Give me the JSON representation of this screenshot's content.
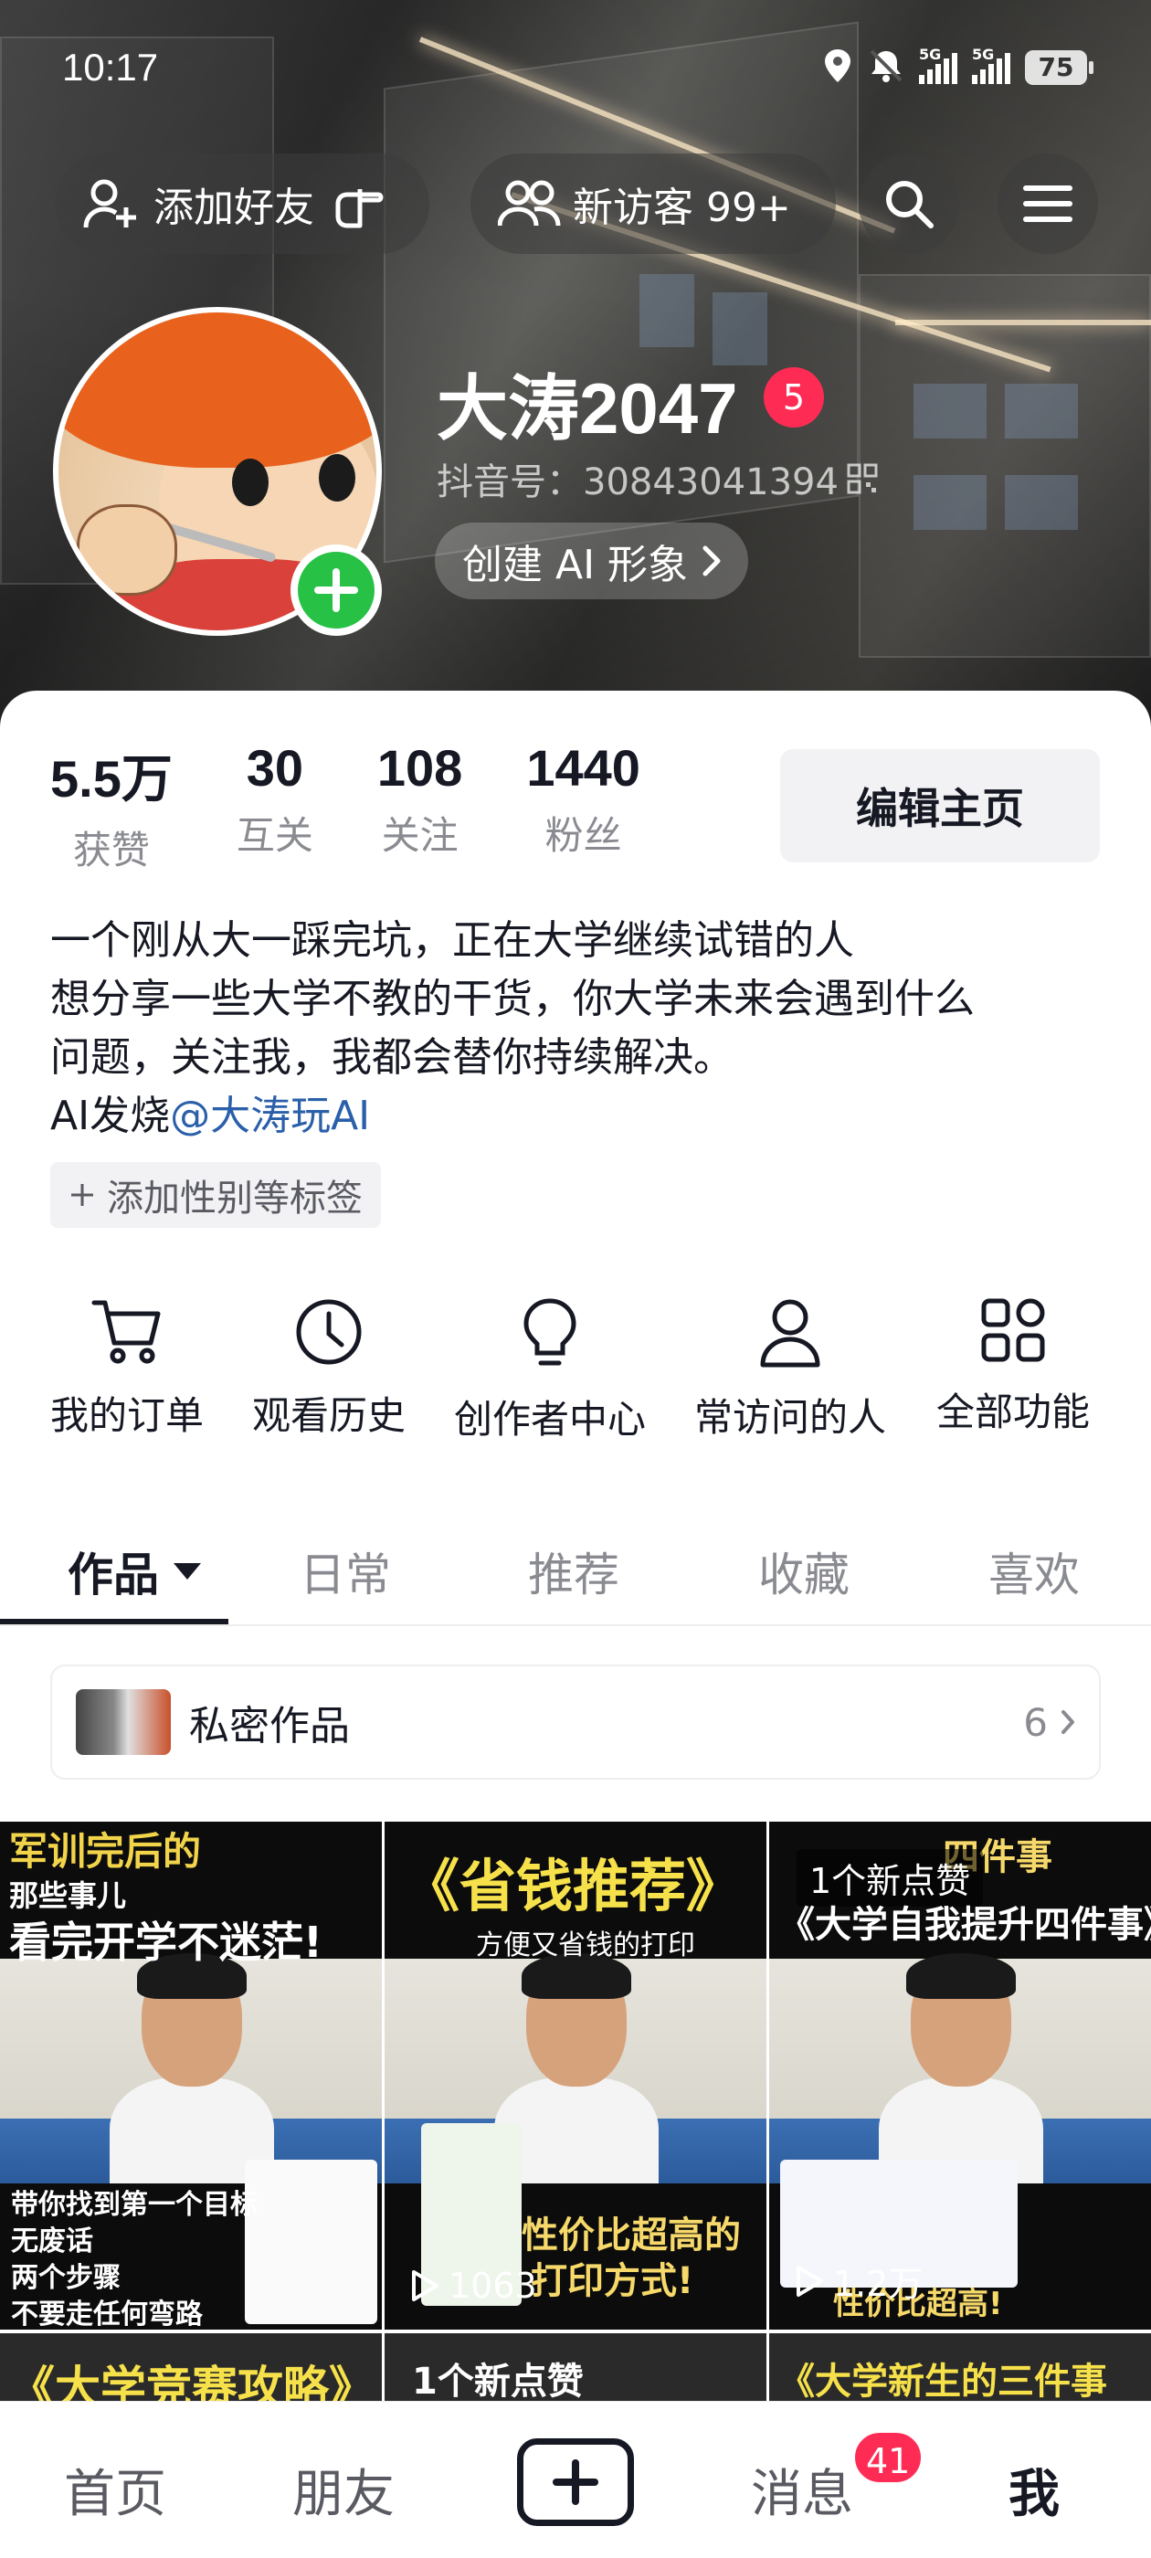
{
  "status_bar": {
    "time": "10:17",
    "signal1": "5G",
    "signal2": "5G",
    "battery": "75"
  },
  "top_actions": {
    "add_friend": "添加好友",
    "new_visitors": "新访客 99+"
  },
  "profile": {
    "name": "大涛2047",
    "name_badge": "5",
    "douyin_id": "抖音号：30843041394",
    "create_ai": "创建 AI 形象"
  },
  "stats": [
    {
      "value": "5.5万",
      "label": "获赞"
    },
    {
      "value": "30",
      "label": "互关"
    },
    {
      "value": "108",
      "label": "关注"
    },
    {
      "value": "1440",
      "label": "粉丝"
    }
  ],
  "edit_profile": "编辑主页",
  "bio": {
    "line1": "一个刚从大一踩完坑，正在大学继续试错的人",
    "line2": "想分享一些大学不教的干货，你大学未来会遇到什么",
    "line3": "问题，关注我，我都会替你持续解决。",
    "line4_prefix": "AI发烧",
    "line4_mention": "@大涛玩AI"
  },
  "add_tag": "添加性别等标签",
  "quick_actions": [
    {
      "label": "我的订单",
      "icon": "cart-icon"
    },
    {
      "label": "观看历史",
      "icon": "clock-icon"
    },
    {
      "label": "创作者中心",
      "icon": "bulb-icon"
    },
    {
      "label": "常访问的人",
      "icon": "person-icon"
    },
    {
      "label": "全部功能",
      "icon": "grid-icon"
    }
  ],
  "tabs": [
    "作品",
    "日常",
    "推荐",
    "收藏",
    "喜欢"
  ],
  "private_works": {
    "label": "私密作品",
    "count": "6"
  },
  "videos": [
    {
      "title_line1": "军训完后的",
      "title_line2": "那些事儿",
      "title_line3": "看完开学不迷茫!",
      "caption_lines": [
        "带你找到第一个目标",
        "无废话",
        "两个步骤",
        "不要走任何弯路"
      ],
      "views": ""
    },
    {
      "title": "《省钱推荐》",
      "subtitle": "方便又省钱的打印",
      "caption_lines": [
        "性价比超高的",
        "打印方式!"
      ],
      "views": "1063"
    },
    {
      "badge": "1个新点赞",
      "title_top": "四件事",
      "title": "《大学自我提升四件事》",
      "caption_lines": [
        "性价比超高!"
      ],
      "views": "1.2万"
    }
  ],
  "videos_row2": [
    {
      "text": "《大学竞赛攻略》"
    },
    {
      "text": "1个新点赞"
    },
    {
      "text": "《大学新生的三件事"
    }
  ],
  "bottom_nav": {
    "home": "首页",
    "friends": "朋友",
    "messages": "消息",
    "messages_badge": "41",
    "me": "我"
  },
  "colors": {
    "accent_red": "#fe2c55",
    "green_plus": "#26c145",
    "mention_blue": "#2a5faa"
  }
}
